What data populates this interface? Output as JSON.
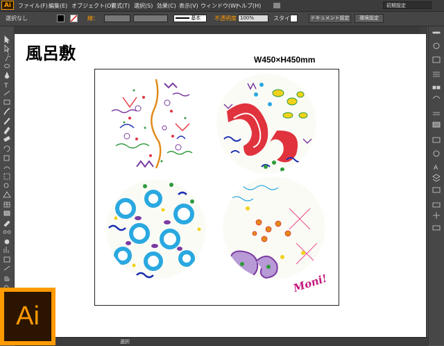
{
  "menubar": {
    "app_logo": "Ai",
    "items": [
      "ファイル(F)",
      "編集(E)",
      "オブジェクト(O)",
      "書式(T)",
      "選択(S)",
      "効果(C)",
      "表示(V)",
      "ウィンドウ(W)",
      "ヘルプ(H)"
    ],
    "workspace": "初期設定"
  },
  "controlbar": {
    "selection": "選択なし",
    "stroke_label": "線：",
    "stroke_style": "基本",
    "opacity_label": "不透明度",
    "opacity_value": "100%",
    "style_label": "スタイル：",
    "doc_setup": "ドキュメント設定",
    "prefs": "環境設定"
  },
  "document": {
    "title": "風呂敷",
    "dims": "W450×H450mm",
    "signature": "Moni!"
  },
  "status": {
    "mode": "選択"
  },
  "badge": {
    "label": "Ai"
  },
  "colors": {
    "accent": "#ff9a00",
    "panel": "#535353",
    "red": "#e0333d",
    "blue": "#1a2fb0",
    "cyan": "#2aa8e0",
    "green": "#2e9a3c",
    "purple": "#7a3aa0",
    "yellow": "#f2d21a",
    "pink": "#e84a8c"
  },
  "tools": [
    "selection-tool",
    "direct-selection-tool",
    "magic-wand-tool",
    "lasso-tool",
    "pen-tool",
    "type-tool",
    "line-tool",
    "rectangle-tool",
    "paintbrush-tool",
    "pencil-tool",
    "blob-brush-tool",
    "eraser-tool",
    "rotate-tool",
    "scale-tool",
    "width-tool",
    "free-transform-tool",
    "shape-builder-tool",
    "perspective-tool",
    "mesh-tool",
    "gradient-tool",
    "eyedropper-tool",
    "blend-tool",
    "symbol-sprayer-tool",
    "column-graph-tool",
    "artboard-tool",
    "slice-tool",
    "hand-tool",
    "zoom-tool",
    "fill-stroke",
    "screen-mode"
  ]
}
